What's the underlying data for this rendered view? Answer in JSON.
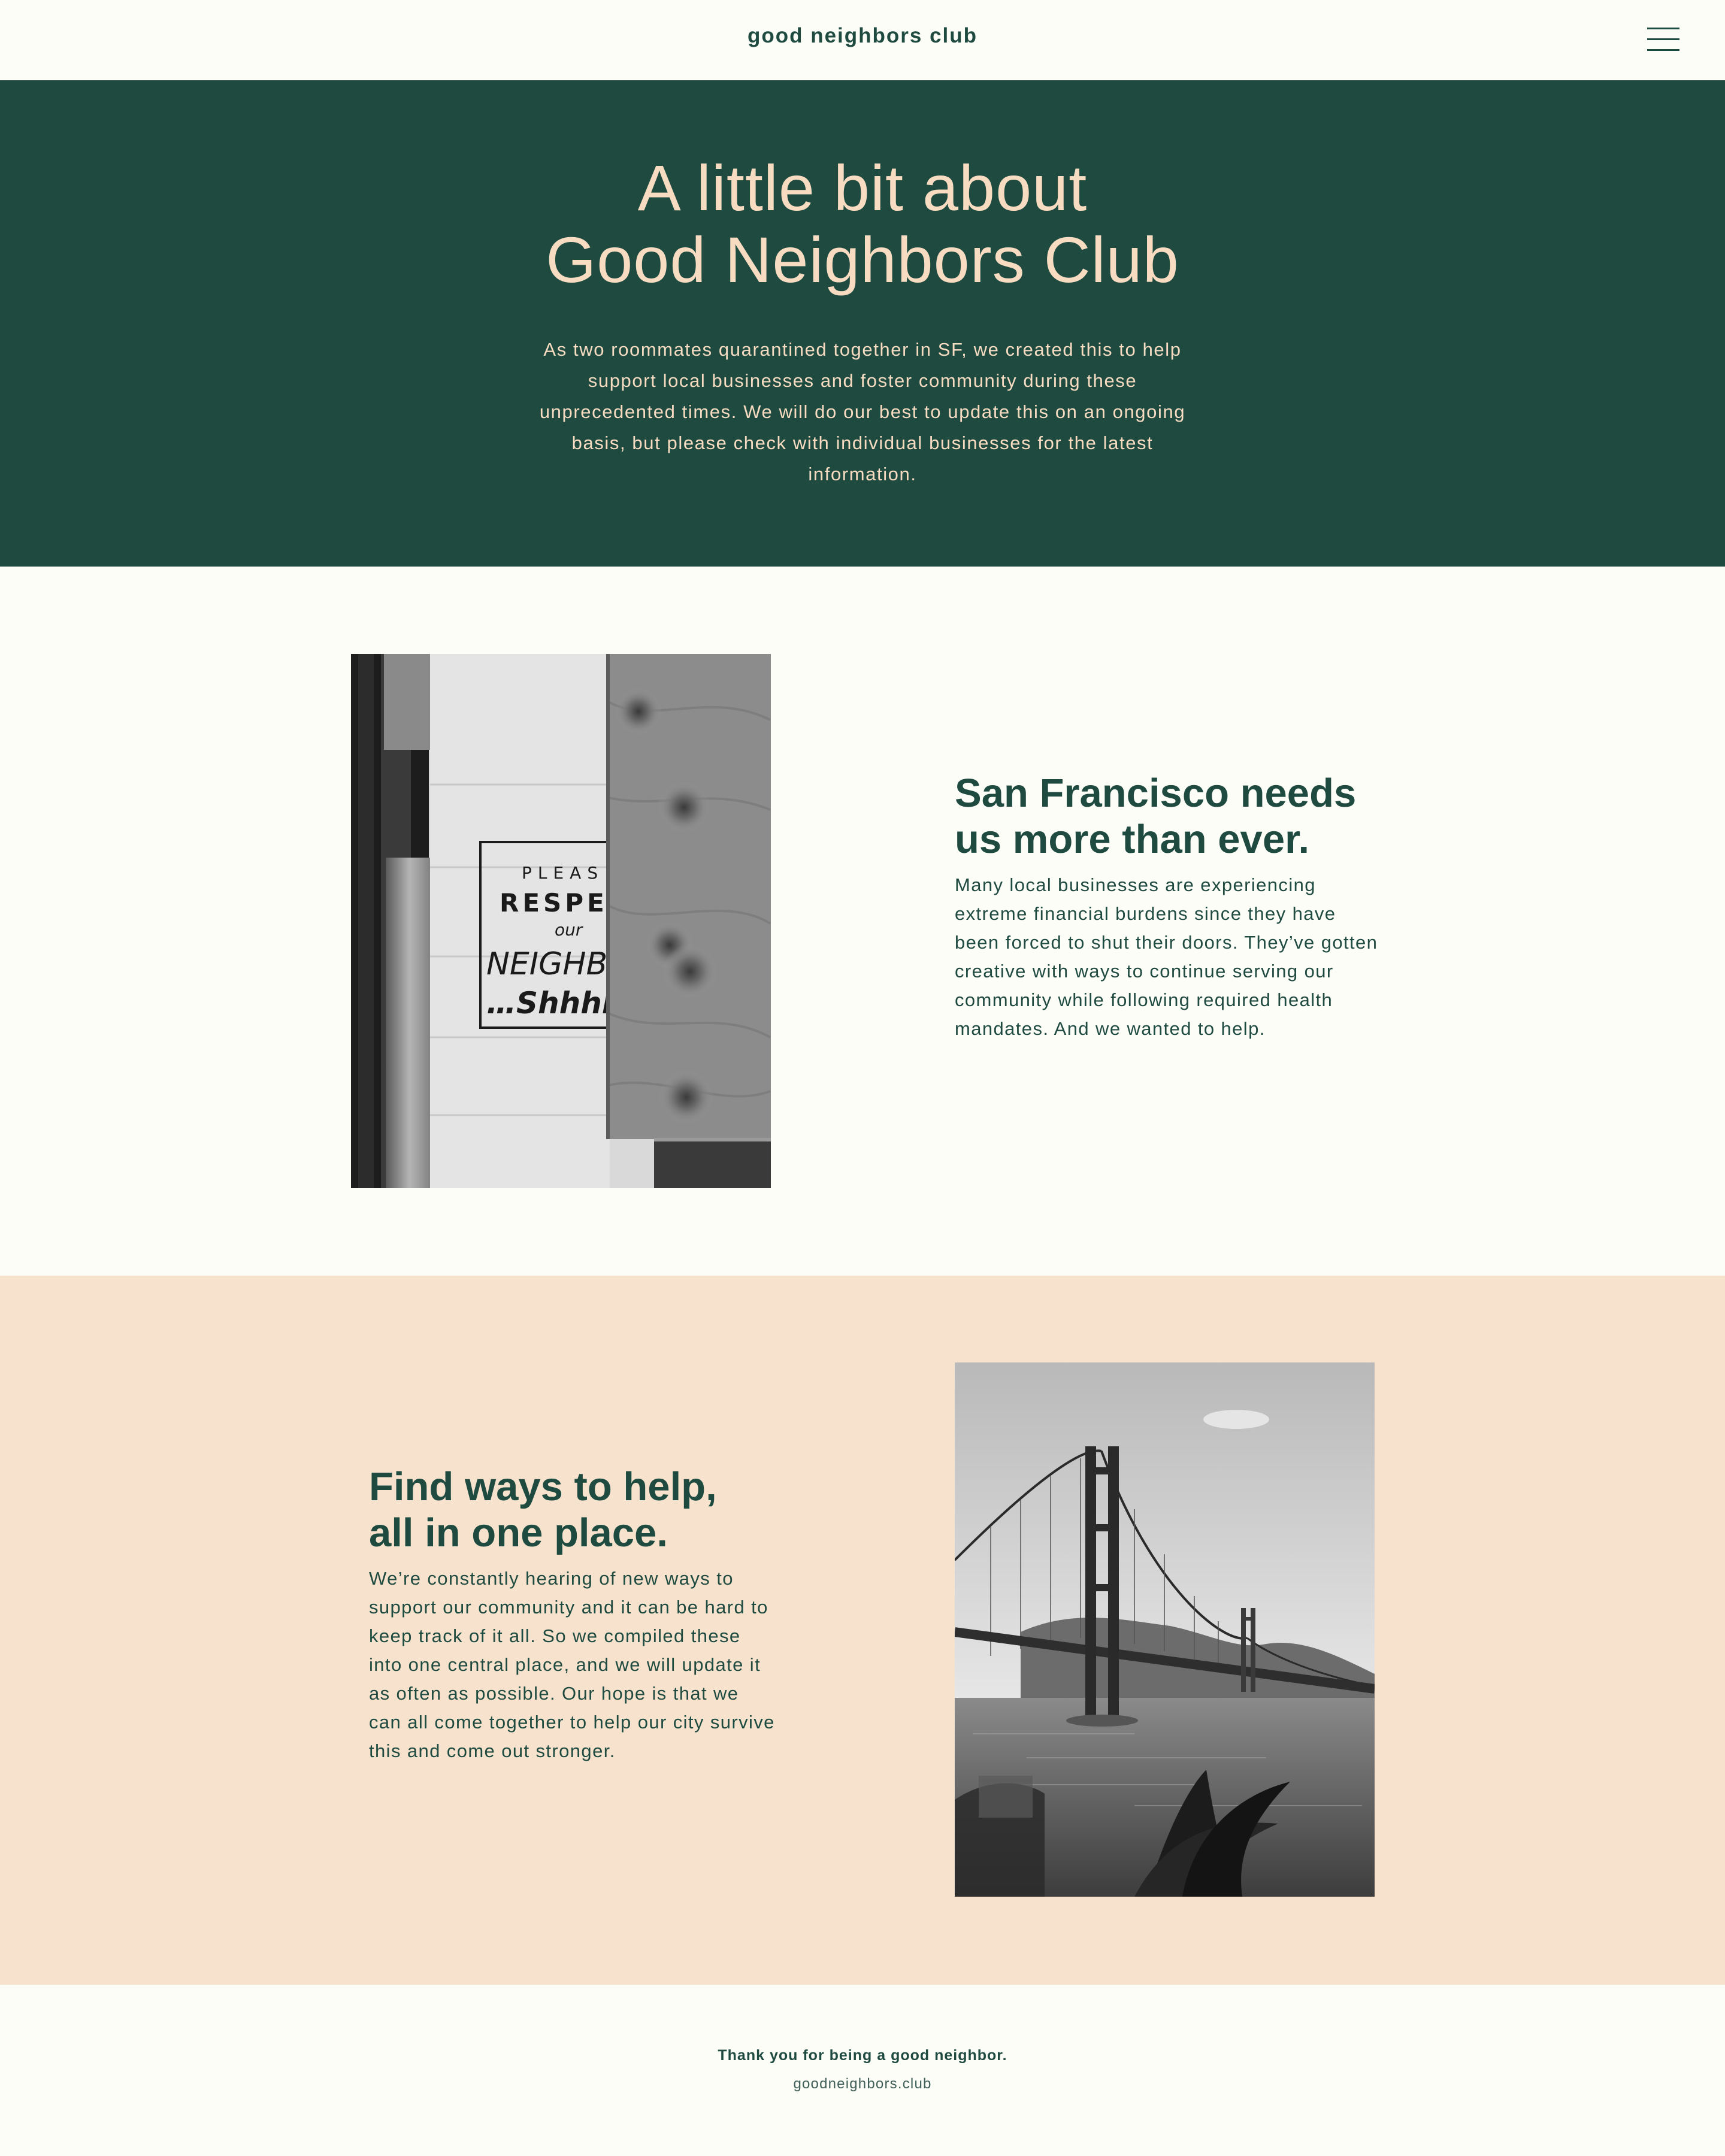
{
  "header": {
    "brand": "good neighbors club",
    "menu_icon": "hamburger-menu-icon"
  },
  "hero": {
    "title_line1": "A little bit about",
    "title_line2": "Good Neighbors Club",
    "text": "As two roommates quarantined together in SF, we created this to help support local businesses and foster community during these unprecedented times. We will do our best to update this on an ongoing basis, but please check with individual businesses for the latest information."
  },
  "section1": {
    "heading_line1": "San Francisco needs",
    "heading_line2": "us more than ever.",
    "body": "Many local businesses are experiencing extreme financial burdens since they have been forced to shut their doors. They’ve gotten creative with ways to continue serving our community while following required health mandates. And we wanted to help.",
    "photo_sign": {
      "line1": "PLEAS",
      "line2": "RESPE",
      "line3": "our",
      "line4": "NEIGHBO",
      "line5": "…Shhhh"
    }
  },
  "section2": {
    "heading_line1": "Find ways to help,",
    "heading_line2": "all in one place.",
    "body": "We’re constantly hearing of new ways to support our community and it can be hard to keep track of it all. So we compiled these into one central place, and we will update it as often as possible. Our hope is that we can all come together to help our city survive this and come out stronger."
  },
  "footer": {
    "thanks": "Thank you for being a good neighbor.",
    "url": "goodneighbors.club"
  },
  "colors": {
    "primary_green": "#1e4a40",
    "peach": "#f7dcc2",
    "peach_bg": "#f7e3cd",
    "off_white": "#fdfdf8"
  }
}
